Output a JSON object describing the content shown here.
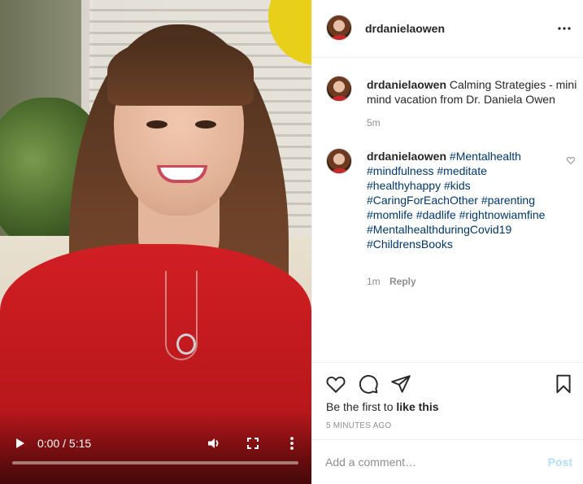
{
  "video": {
    "time_display": "0:00 / 5:15",
    "progress": 0,
    "controls": {
      "play_icon": "play-icon",
      "volume_icon": "volume-icon",
      "fullscreen_icon": "fullscreen-icon",
      "more_icon": "more-vertical-icon"
    }
  },
  "header": {
    "username": "drdanielaowen",
    "more_icon": "more-horizontal-icon"
  },
  "caption": {
    "username": "drdanielaowen",
    "text": "Calming Strategies - mini mind vacation from Dr. Daniela Owen",
    "time": "5m"
  },
  "comment": {
    "username": "drdanielaowen",
    "hashtags": [
      "#Mentalhealth",
      "#mindfulness",
      "#meditate",
      "#healthyhappy",
      "#kids",
      "#CaringForEachOther",
      "#parenting",
      "#momlife",
      "#dadlife",
      "#rightnowiamfine",
      "#MentalhealthduringCovid19",
      "#ChildrensBooks"
    ],
    "time": "1m",
    "reply_label": "Reply"
  },
  "actions": {
    "likes_prefix": "Be the first to ",
    "likes_link": "like this",
    "posted_ago": "5 MINUTES AGO"
  },
  "add_comment": {
    "placeholder": "Add a comment…",
    "post_label": "Post"
  },
  "colors": {
    "link_blue": "#00376b",
    "post_disabled": "#b2dffc",
    "muted": "#8e8e8e"
  }
}
